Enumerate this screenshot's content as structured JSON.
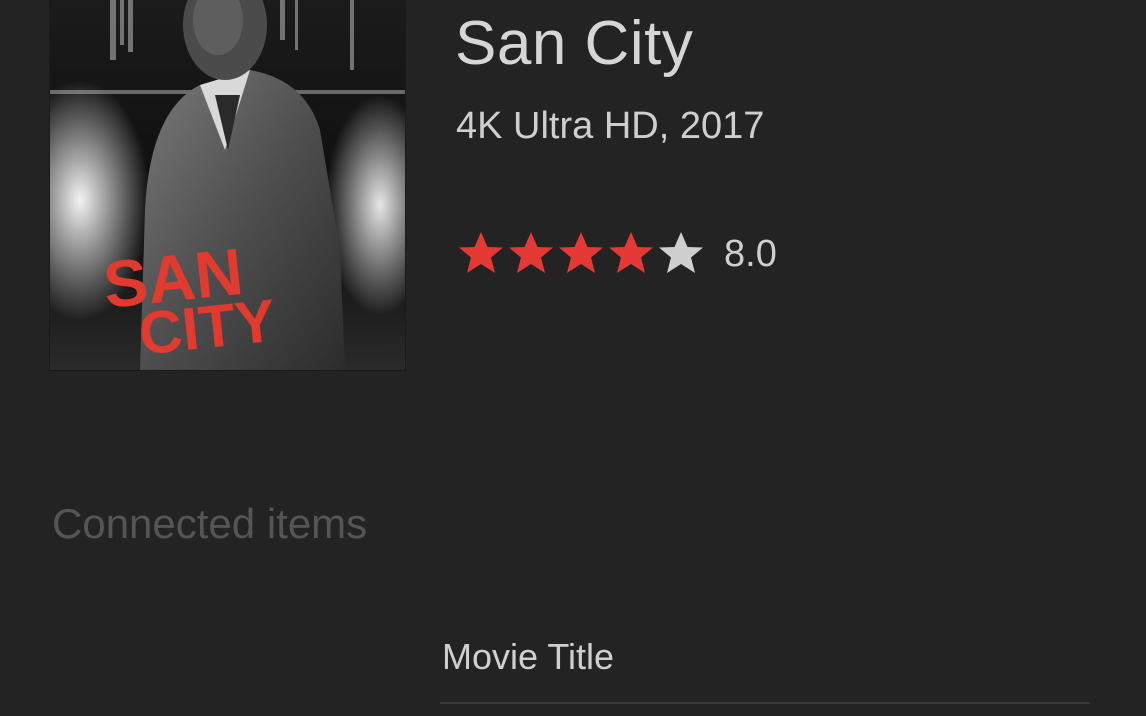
{
  "movie": {
    "title": "San City",
    "format_year": "4K Ultra HD, 2017",
    "rating": {
      "stars_total": 5,
      "stars_filled": 4,
      "value_label": "8.0"
    },
    "poster": {
      "logo_text_line1": "SAN",
      "logo_text_line2": "CITY"
    }
  },
  "connected": {
    "header": "Connected items",
    "items": [
      {
        "label": "Movie Title"
      }
    ]
  },
  "colors": {
    "background": "#232323",
    "star_filled": "#e53935",
    "star_empty": "#cfcfcf",
    "poster_logo": "#e23a2e"
  },
  "icons": {
    "star": "star-icon"
  }
}
